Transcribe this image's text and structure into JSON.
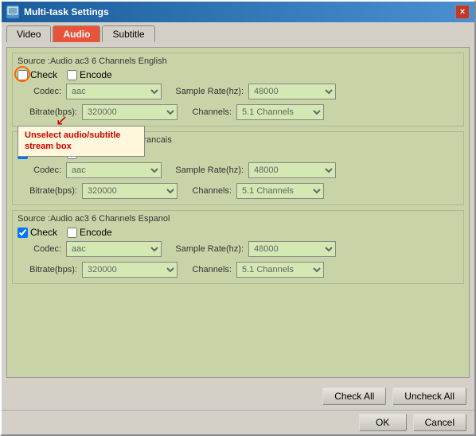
{
  "window": {
    "title": "Multi-task Settings",
    "close_label": "×"
  },
  "tabs": [
    {
      "id": "video",
      "label": "Video",
      "active": false
    },
    {
      "id": "audio",
      "label": "Audio",
      "active": true
    },
    {
      "id": "subtitle",
      "label": "Subtitle",
      "active": false
    }
  ],
  "streams": [
    {
      "source": "Source :Audio  ac3  6 Channels  English",
      "check": false,
      "encode": false,
      "codec": "aac",
      "bitrate": "320000",
      "sample_rate": "48000",
      "channels": "5.1 Channels"
    },
    {
      "source": "Source :Audio  ac3  6 Channels  Francais",
      "check": true,
      "encode": false,
      "codec": "aac",
      "bitrate": "320000",
      "sample_rate": "48000",
      "channels": "5.1 Channels"
    },
    {
      "source": "Source :Audio  ac3  6 Channels  Espanol",
      "check": true,
      "encode": false,
      "codec": "aac",
      "bitrate": "320000",
      "sample_rate": "48000",
      "channels": "5.1 Channels"
    }
  ],
  "tooltip": "Unselect audio/subtitle stream box",
  "buttons": {
    "check_all": "Check All",
    "uncheck_all": "Uncheck All",
    "ok": "OK",
    "cancel": "Cancel"
  },
  "labels": {
    "check": "Check",
    "encode": "Encode",
    "codec": "Codec:",
    "bitrate": "Bitrate(bps):",
    "sample_rate": "Sample Rate(hz):",
    "channels": "Channels:"
  }
}
